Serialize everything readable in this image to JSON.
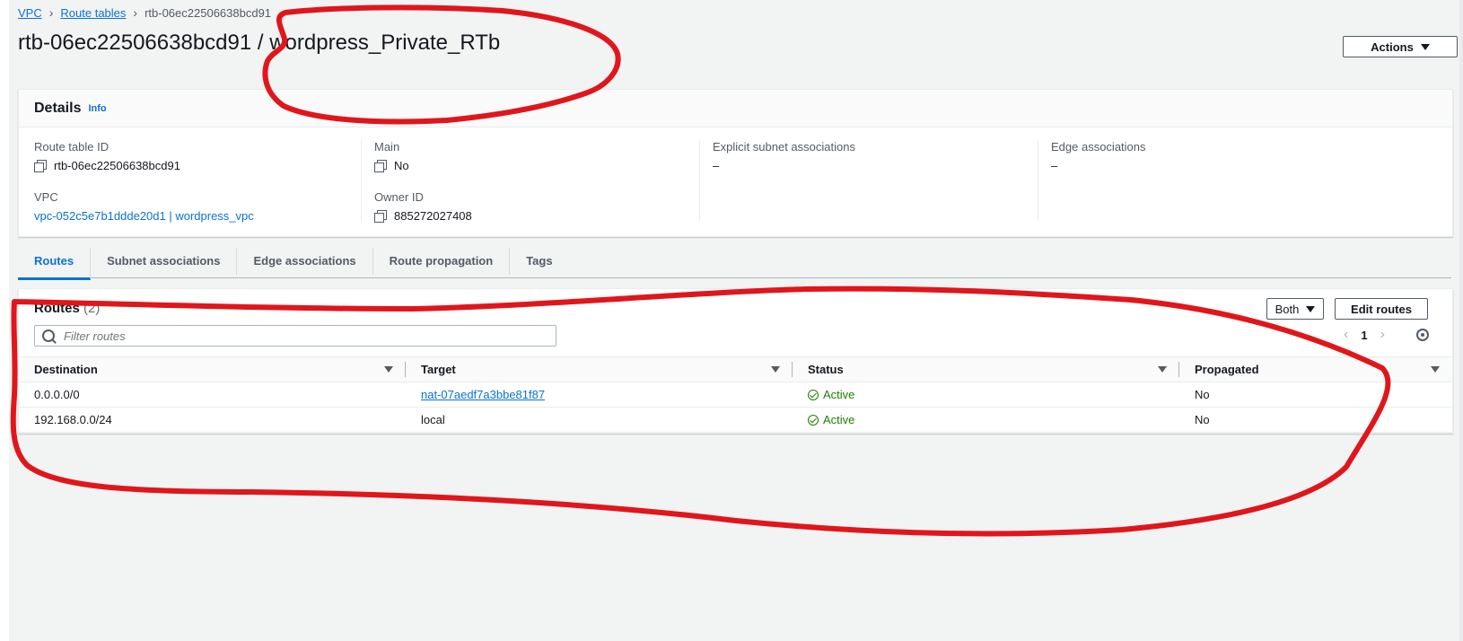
{
  "breadcrumb": {
    "vpc": "VPC",
    "route_tables": "Route tables",
    "current": "rtb-06ec22506638bcd91"
  },
  "page_title": "rtb-06ec22506638bcd91 / wordpress_Private_RTb",
  "actions_label": "Actions",
  "details": {
    "title": "Details",
    "info": "Info",
    "route_table_id_label": "Route table ID",
    "route_table_id": "rtb-06ec22506638bcd91",
    "vpc_label": "VPC",
    "vpc_value": "vpc-052c5e7b1ddde20d1 | wordpress_vpc",
    "main_label": "Main",
    "main_value": "No",
    "owner_label": "Owner ID",
    "owner_value": "885272027408",
    "explicit_label": "Explicit subnet associations",
    "explicit_value": "–",
    "edge_label": "Edge associations",
    "edge_value": "–"
  },
  "tabs": [
    "Routes",
    "Subnet associations",
    "Edge associations",
    "Route propagation",
    "Tags"
  ],
  "routes": {
    "title": "Routes",
    "count": "(2)",
    "both_label": "Both",
    "edit_label": "Edit routes",
    "filter_placeholder": "Filter routes",
    "page": "1",
    "columns": [
      "Destination",
      "Target",
      "Status",
      "Propagated"
    ],
    "rows": [
      {
        "destination": "0.0.0.0/0",
        "target": "nat-07aedf7a3bbe81f87",
        "status": "Active",
        "propagated": "No"
      },
      {
        "destination": "192.168.0.0/24",
        "target": "local",
        "status": "Active",
        "propagated": "No"
      }
    ]
  },
  "colors": {
    "link": "#0972d3",
    "success": "#1d8102",
    "annotation": "#e0161b"
  }
}
